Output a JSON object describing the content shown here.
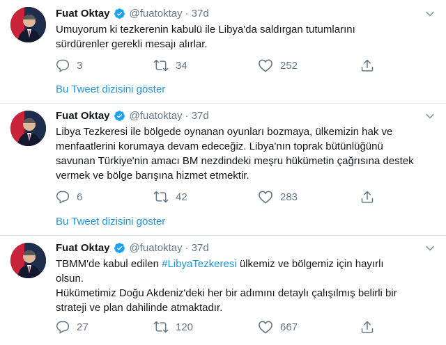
{
  "tweets": [
    {
      "name": "Fuat Oktay",
      "handle": "@fuatoktay",
      "separator": "·",
      "time": "37d",
      "lines": [
        "Umuyorum ki tezkerenin kabulü ile Libya'da saldırgan tutumlarını",
        "sürdürenler gerekli mesajı alırlar."
      ],
      "replies": "3",
      "retweets": "34",
      "likes": "252",
      "thread_link": "Bu Tweet dizisini göster"
    },
    {
      "name": "Fuat Oktay",
      "handle": "@fuatoktay",
      "separator": "·",
      "time": "37d",
      "lines": [
        "Libya Tezkeresi ile bölgede oynanan oyunları bozmaya, ülkemizin hak ve",
        "menfaatlerini korumaya devam edeceğiz. Libya'nın toprak bütünlüğünü",
        "savunan Türkiye'nin amacı BM nezdindeki meşru hükümetin çağrısına destek",
        "vermek ve bölge barışına hizmet etmektir."
      ],
      "replies": "6",
      "retweets": "42",
      "likes": "283",
      "thread_link": "Bu Tweet dizisini göster"
    },
    {
      "name": "Fuat Oktay",
      "handle": "@fuatoktay",
      "separator": "·",
      "time": "37d",
      "line1_prefix": "TBMM'de kabul edilen ",
      "hashtag": "#LibyaTezkeresi",
      "line1_suffix": " ülkemiz ve bölgemiz için hayırlı",
      "lines": [
        "olsun.",
        "Hükümetimiz Doğu Akdeniz'deki her bir adımını detaylı çalışılmış belirli bir",
        "strateji ve plan dahilinde atmaktadır."
      ],
      "replies": "27",
      "retweets": "120",
      "likes": "667"
    }
  ],
  "colors": {
    "link": "#1b95e0",
    "secondary_text": "#657786",
    "verified": "#1da1f2",
    "divider": "#e6ecf0"
  },
  "icons": [
    "reply-icon",
    "retweet-icon",
    "like-icon",
    "share-icon",
    "verified-badge-icon",
    "caret-down-icon"
  ]
}
